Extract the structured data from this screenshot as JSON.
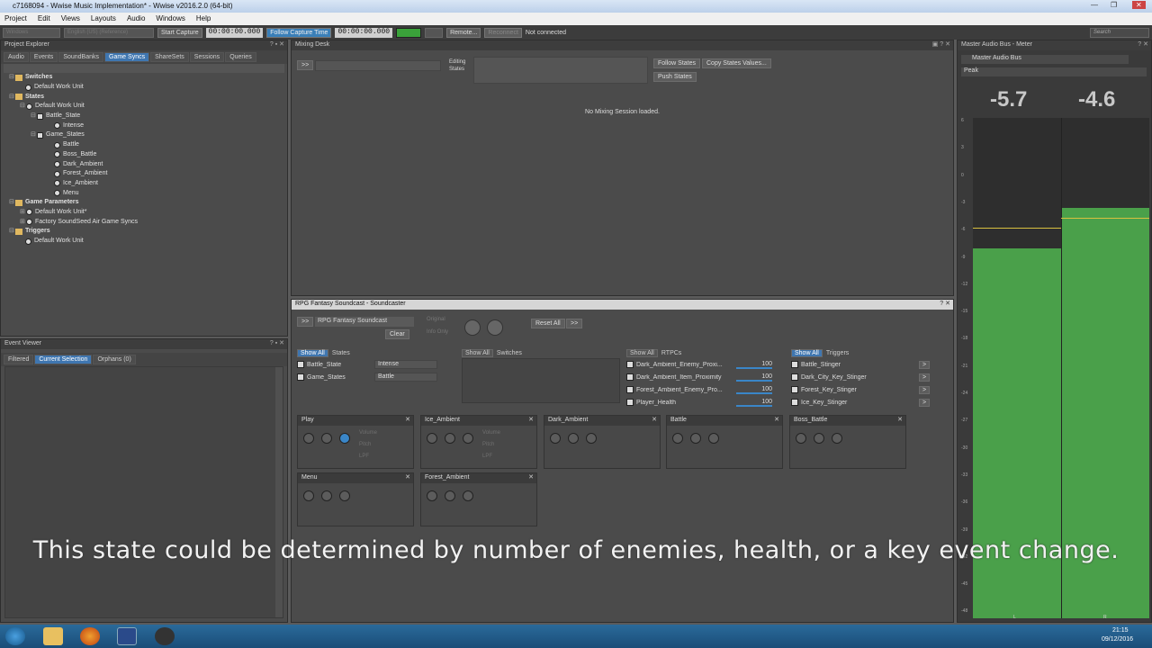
{
  "titlebar": {
    "text": "c7168094 - Wwise Music Implementation* - Wwise v2016.2.0 (64-bit)"
  },
  "menu": [
    "Project",
    "Edit",
    "Views",
    "Layouts",
    "Audio",
    "Windows",
    "Help"
  ],
  "toolbar": {
    "platform": "Windows",
    "language": "English (US) (Reference)",
    "start_capture": "Start Capture",
    "time1": "00:00:00.000",
    "follow": "Follow Capture Time",
    "time2": "00:00:00.000",
    "remote": "Remote...",
    "reconnect": "Reconnect",
    "status": "Not connected",
    "search": "Search"
  },
  "project_explorer": {
    "title": "Project Explorer",
    "tabs": [
      "Audio",
      "Events",
      "SoundBanks",
      "Game Syncs",
      "ShareSets",
      "Sessions",
      "Queries"
    ],
    "tree": [
      "Switches",
      "Default Work Unit",
      "States",
      "Default Work Unit",
      "Battle_State",
      "Intense",
      "Game_States",
      "Battle",
      "Boss_Battle",
      "Dark_Ambient",
      "Forest_Ambient",
      "Ice_Ambient",
      "Menu",
      "Game Parameters",
      "Default Work Unit*",
      "Factory SoundSeed Air Game Syncs",
      "Triggers",
      "Default Work Unit"
    ]
  },
  "event_viewer": {
    "title": "Event Viewer",
    "tabs": [
      "Filtered",
      "Current Selection",
      "Orphans (0)"
    ]
  },
  "mixing_desk": {
    "title": "Mixing Desk",
    "editing_states": "Editing States",
    "follow_states": "Follow States",
    "copy_states": "Copy States Values...",
    "push_states": "Push States",
    "empty": "No Mixing Session loaded."
  },
  "soundcaster": {
    "title": "RPG Fantasy Soundcast - Soundcaster",
    "session": "RPG Fantasy Soundcast",
    "clear": "Clear",
    "original": "Original",
    "info_only": "Info Only",
    "reset_all": "Reset All",
    "show_all": "Show All",
    "states_label": "States",
    "switches_label": "Switches",
    "rtpcs_label": "RTPCs",
    "triggers_label": "Triggers",
    "states": [
      {
        "name": "Battle_State",
        "value": "Intense"
      },
      {
        "name": "Game_States",
        "value": "Battle"
      }
    ],
    "rtpcs": [
      {
        "name": "Dark_Ambient_Enemy_Proxi...",
        "value": "100"
      },
      {
        "name": "Dark_Ambient_Item_Proximity",
        "value": "100"
      },
      {
        "name": "Forest_Ambient_Enemy_Pro...",
        "value": "100"
      },
      {
        "name": "Player_Health",
        "value": "100"
      }
    ],
    "triggers": [
      "Battle_Stinger",
      "Dark_City_Key_Stinger",
      "Forest_Key_Stinger",
      "Ice_Key_Stinger"
    ],
    "tiles": [
      "Play",
      "Ice_Ambient",
      "Dark_Ambient",
      "Battle",
      "Boss_Battle",
      "Menu",
      "Forest_Ambient"
    ],
    "tile_labels": {
      "volume": "Volume",
      "pitch": "Pitch",
      "lpf": "LPF"
    }
  },
  "meter": {
    "title": "Master Audio Bus - Meter",
    "bus": "Master Audio Bus",
    "mode": "Peak",
    "peak_left": "-5.7",
    "peak_right": "-4.6",
    "scale": [
      "6",
      "3",
      "0",
      "-3",
      "-6",
      "-9",
      "-12",
      "-15",
      "-18",
      "-21",
      "-24",
      "-27",
      "-30",
      "-33",
      "-36",
      "-39",
      "-42",
      "-45",
      "-48"
    ],
    "ch_left": "L",
    "ch_right": "R",
    "level_left": 0.74,
    "level_right": 0.82,
    "color": "#4aa04a"
  },
  "subtitle": "This state could be determined by number of enemies, health, or a key event change.",
  "clock": {
    "time": "21:15",
    "date": "09/12/2016"
  }
}
